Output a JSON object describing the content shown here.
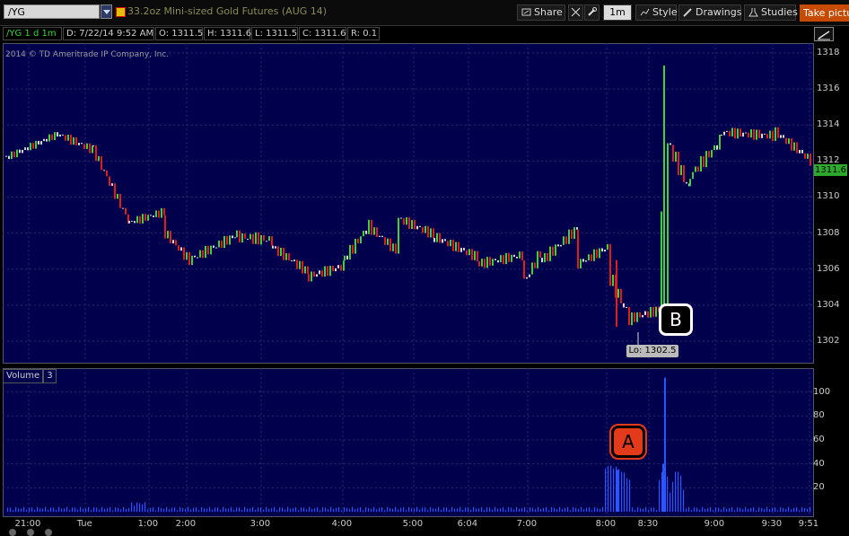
{
  "toolbar": {
    "symbol": "/YG",
    "description": "33.2oz Mini-sized Gold Futures (AUG 14)",
    "share_label": "Share",
    "interval_label": "1m",
    "style_label": "Style",
    "drawings_label": "Drawings",
    "studies_label": "Studies",
    "take_picture_label": "Take pictur"
  },
  "infobar": {
    "study": "/YG 1 d 1m",
    "date": "D: 7/22/14 9:52 AM",
    "open": "O: 1311.5",
    "high": "H: 1311.6",
    "low": "L: 1311.5",
    "close": "C: 1311.6",
    "range": "R: 0.1"
  },
  "copyright": "2014 © TD Ameritrade IP Company, Inc.",
  "price_axis": [
    "1318",
    "1316",
    "1314",
    "1312",
    "1310",
    "1308",
    "1306",
    "1304",
    "1302"
  ],
  "last_price": "1311.6",
  "low_label": "Lo: 1302.5",
  "callouts": {
    "a": "A",
    "b": "B"
  },
  "volume": {
    "label": "Volume",
    "count": "3",
    "axis": [
      "100",
      "80",
      "60",
      "40",
      "20"
    ]
  },
  "time_axis": [
    "21:00",
    "Tue",
    "1:00",
    "2:00",
    "3:00",
    "4:00",
    "5:00",
    "6:04",
    "7:00",
    "8:00",
    "8:30",
    "9:00",
    "9:30",
    "9:51"
  ],
  "colors": {
    "panel": "#00004d",
    "up": "#3cd23c",
    "down": "#e21b1b",
    "neutral": "#d8d8d8",
    "volume": "#2a55ff",
    "callout": "#e23a1a",
    "accent": "#c64a00"
  }
}
